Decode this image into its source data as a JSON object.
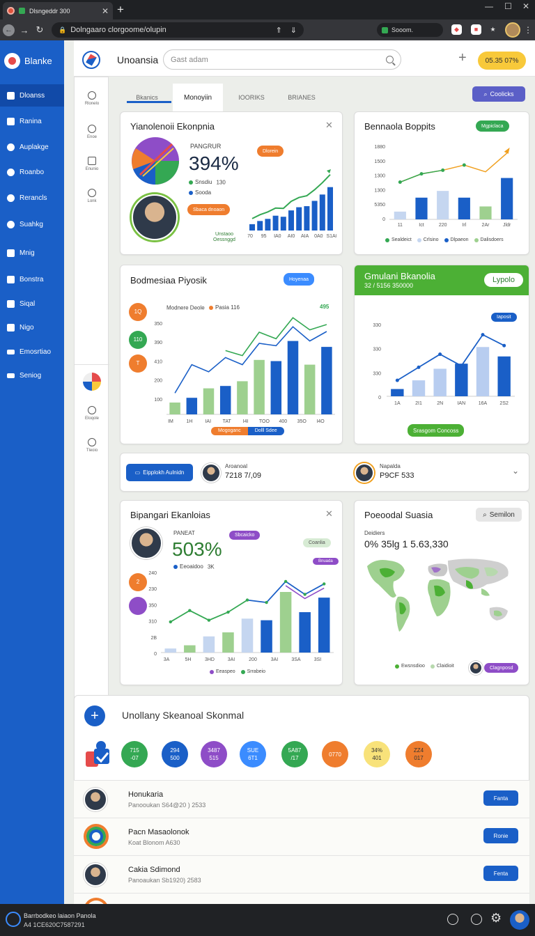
{
  "browser": {
    "tab_title": "Dlsngeddr 300",
    "url": "Dolngaaro clorgoome/olupin",
    "ext_label": "Sooom."
  },
  "sidebar": {
    "brand": "Blanke",
    "items": [
      {
        "label": "Dloanss"
      },
      {
        "label": "Ranina"
      },
      {
        "label": "Auplakge"
      },
      {
        "label": "Roanbo"
      },
      {
        "label": "Rerancls"
      },
      {
        "label": "Suahkg"
      },
      {
        "label": "Mnig"
      },
      {
        "label": "Bonstra"
      },
      {
        "label": "Siqal"
      },
      {
        "label": "Nigo"
      },
      {
        "label": "Emosrtiao"
      },
      {
        "label": "Seniog"
      }
    ]
  },
  "header": {
    "title": "Unoansia",
    "search_placeholder": "Gast adam",
    "pill": "05.35 07%"
  },
  "rail": {
    "labels": [
      "Rlonelo",
      "Enoe",
      "Enunio",
      "Lonk",
      "Eloqole",
      "Tleoio"
    ]
  },
  "tabs": [
    "Bkanics",
    "Monoyiin",
    "IOORIKS",
    "BRIANES"
  ],
  "cookies_label": "Coolicks",
  "card1": {
    "title": "Yianolenoii Ekonpnia",
    "metric_label": "PANGRUR",
    "metric": "394%",
    "legend": [
      {
        "label": "Snsdiu",
        "value": "130",
        "color": "#34a853"
      },
      {
        "label": "Sooda",
        "value": "",
        "color": "#1a5fc7"
      }
    ],
    "tag1": "Dlorein",
    "tag2": "Sbaca dnoaon",
    "footer": "Unstaoo Oessnggd",
    "x_labels": [
      "70",
      "95",
      "IA0",
      "AI0",
      "AIA",
      "0A0",
      "S1A0"
    ],
    "bar_values": [
      12,
      18,
      22,
      28,
      26,
      38,
      44,
      46,
      56,
      68,
      82
    ]
  },
  "card2": {
    "title": "Bennaola Boppits",
    "tag": "Mgpiclaca",
    "y_ticks": [
      "1880",
      "1500",
      "1300",
      "1300",
      "5350",
      "0"
    ],
    "x_labels": [
      "11",
      "Ict",
      "220",
      "Irl",
      "2Ar",
      "Jldr"
    ],
    "series_a": [
      15,
      42,
      55,
      42,
      25,
      80
    ],
    "series_b": [
      72,
      88,
      95,
      105,
      92,
      128
    ],
    "legend": [
      "Sealdeict",
      "Crlsino",
      "Dlpaeon",
      "Dalisdoers"
    ]
  },
  "card3": {
    "title": "Bodmesiaa Piyosik",
    "tag": "Hoyenaa",
    "legend": "Modnere Deole",
    "legend2": "Pasia 116",
    "value": "495",
    "y_ticks": [
      "350",
      "390",
      "410",
      "200",
      "100"
    ],
    "x_labels": [
      "IM",
      "1H",
      "IAI",
      "TAT",
      "I4I",
      "TOO",
      "400",
      "35O",
      "I4O"
    ],
    "chips": [
      {
        "text": "1Q",
        "color": "#ef7d2e"
      },
      {
        "text": "110",
        "color": "#34a853"
      },
      {
        "text": "T",
        "color": "#ef7d2e"
      }
    ],
    "bars": [
      10,
      14,
      22,
      24,
      28,
      46,
      45,
      62,
      42,
      57
    ],
    "line": [
      18,
      42,
      36,
      48,
      42,
      60,
      58,
      74,
      62,
      70
    ],
    "footer_a": "Mogoganc",
    "footer_b": "Dolll Sdee"
  },
  "card4": {
    "title": "Gmulani Bkanolia",
    "subtitle": "32 / 5156 350000",
    "button": "Lypolo",
    "tag": "Iaposit",
    "y_ticks": [
      "330",
      "330",
      "330",
      "0"
    ],
    "x_labels": [
      "1A",
      "2I1",
      "2N",
      "IAN",
      "16A",
      "2S2"
    ],
    "bars": [
      10,
      22,
      38,
      45,
      68,
      55
    ],
    "line": [
      22,
      40,
      58,
      42,
      85,
      70
    ],
    "footer": "Srasgom Concoss"
  },
  "strip": {
    "button": "Eipplokh Aulnidn",
    "p1_label": "Aroanoal",
    "p1_value": "7218 7/,09",
    "p2_label": "Napalda",
    "p2_value": "P9CF 533"
  },
  "card5": {
    "title": "Bipangari Ekanloias",
    "metric_label": "PANEAT",
    "metric": "503%",
    "tag": "Sbcaicko",
    "tag2": "Coanlia",
    "tag3": "Bnuada",
    "legend_label": "Eeoaidoo",
    "legend_value": "3K",
    "chips": [
      {
        "text": "2",
        "color": "#ef7d2e"
      },
      {
        "text": "",
        "color": "#8e4dc7"
      }
    ],
    "y_ticks": [
      "240",
      "230",
      "350",
      "310",
      "2B",
      "0"
    ],
    "x_labels": [
      "3A",
      "5H",
      "3HD",
      "3AI",
      "200",
      "3AI",
      "3SA",
      "3SI"
    ],
    "bars": [
      5,
      9,
      20,
      25,
      42,
      40,
      75,
      50,
      68
    ],
    "line": [
      38,
      52,
      40,
      50,
      65,
      62,
      88,
      72,
      85
    ],
    "legend": [
      "Eeaspeo",
      "Srrabeio"
    ]
  },
  "card6": {
    "title": "Poeoodal Suasia",
    "button": "Semilon",
    "label": "Deidiers",
    "value": "0% 35lg 1 5.63,330",
    "legend_a": "Ewsnsdioo",
    "legend_b": "Claidioit",
    "tag": "Clagnposd"
  },
  "bottom": {
    "title": "Unollany Skeanoal Skonmal",
    "circles": [
      {
        "a": "715",
        "b": "-07",
        "color": "#34a853"
      },
      {
        "a": "294",
        "b": "500",
        "color": "#1a5fc7"
      },
      {
        "a": "3487",
        "b": "515",
        "color": "#8e4dc7"
      },
      {
        "a": "SUE",
        "b": "6T1",
        "color": "#3b8cff"
      },
      {
        "a": "5A87",
        "b": "/17",
        "color": "#34a853"
      },
      {
        "a": "0770",
        "b": "",
        "color": "#ef7d2e"
      },
      {
        "a": "34%",
        "b": "401",
        "color": "#f8d94a"
      },
      {
        "a": "ZZ4",
        "b": "017",
        "color": "#ef7d2e"
      }
    ],
    "rows": [
      {
        "name": "Honukaria",
        "sub": "Panooukan S64@20 ) 2533",
        "button": "Fanta"
      },
      {
        "name": "Pacn Masaolonok",
        "sub": "Koat Blonom A630",
        "button": "Ronie"
      },
      {
        "name": "Cakia Sdimond",
        "sub": "Panoaukan Sb1920) 2583",
        "button": "Fenta"
      }
    ]
  },
  "taskbar": {
    "line1": "Barrbodkeo laiaon Panola",
    "line2": "A4 1CE620C7587291"
  },
  "colors": {
    "primary": "#1a5fc7",
    "green": "#34a853",
    "orange": "#ef7d2e",
    "purple": "#8e4dc7",
    "yellow": "#f8c93a"
  }
}
